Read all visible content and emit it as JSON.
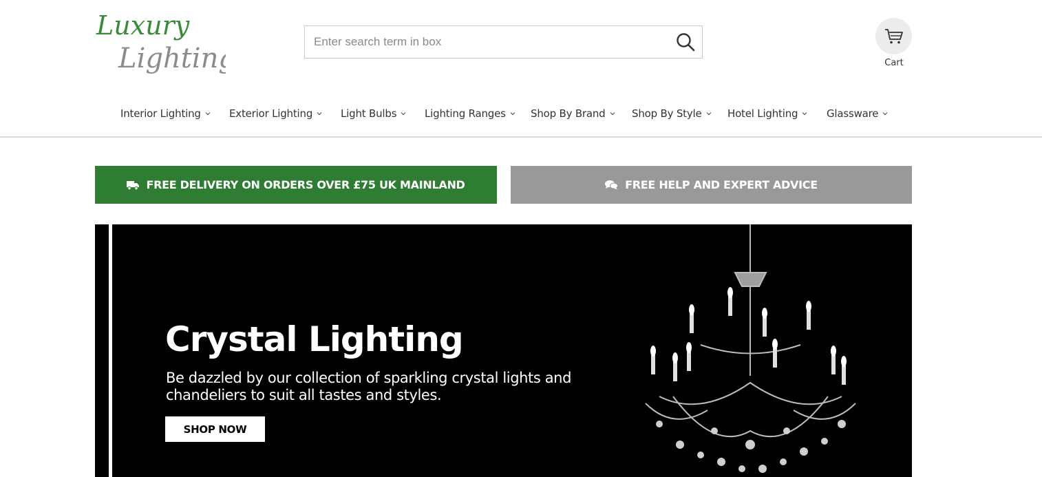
{
  "logo": {
    "line1": "Luxury",
    "line2": "Lighting",
    "color": "#3a8a3a"
  },
  "search": {
    "placeholder": "Enter search term in box",
    "icon": "search-icon"
  },
  "cart": {
    "label": "Cart",
    "icon": "cart-icon"
  },
  "nav": {
    "items": [
      {
        "label": "Interior Lighting"
      },
      {
        "label": "Exterior Lighting"
      },
      {
        "label": "Light Bulbs"
      },
      {
        "label": "Lighting Ranges"
      },
      {
        "label": "Shop By Brand"
      },
      {
        "label": "Shop By Style"
      },
      {
        "label": "Hotel Lighting"
      },
      {
        "label": "Glassware"
      }
    ]
  },
  "banners": {
    "delivery": {
      "label": "FREE DELIVERY ON ORDERS OVER £75 UK MAINLAND",
      "icon": "truck-icon",
      "color": "#2e7d32"
    },
    "help": {
      "label": "FREE HELP AND EXPERT ADVICE",
      "icon": "chat-icon",
      "color": "#999999"
    }
  },
  "hero": {
    "title": "Crystal Lighting",
    "subtitle": "Be dazzled by our collection of sparkling crystal lights and chandeliers to suit all tastes and styles.",
    "button": "SHOP NOW",
    "image": "crystal-chandelier"
  }
}
